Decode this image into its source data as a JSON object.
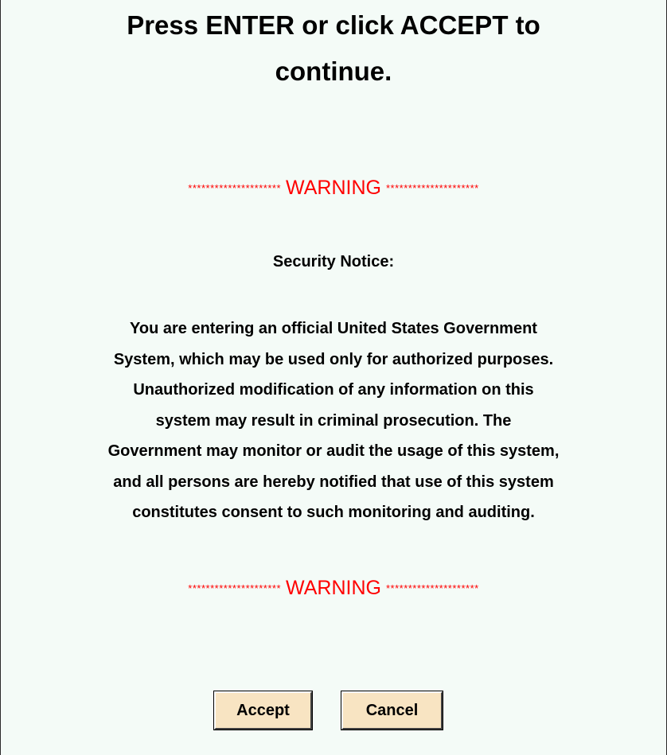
{
  "heading": {
    "line1": "Press ENTER or click ACCEPT to",
    "line2": "continue."
  },
  "warning": {
    "stars_left": "*********************",
    "word": "WARNING",
    "stars_right": "*********************"
  },
  "notice": {
    "title": "Security Notice:",
    "lines": [
      "You are entering an official United States Government",
      "System, which may be used only for authorized purposes.",
      "Unauthorized modification of any information on this",
      "system may result in criminal prosecution. The",
      "Government may monitor or audit the usage of this system,",
      "and all persons are hereby notified that use of this system",
      "constitutes consent to such monitoring and auditing."
    ]
  },
  "buttons": {
    "accept_label": "Accept",
    "cancel_label": "Cancel"
  },
  "colors": {
    "background": "#f4fbf7",
    "warning": "#ff0000",
    "button_bg": "#f8e4c2"
  }
}
